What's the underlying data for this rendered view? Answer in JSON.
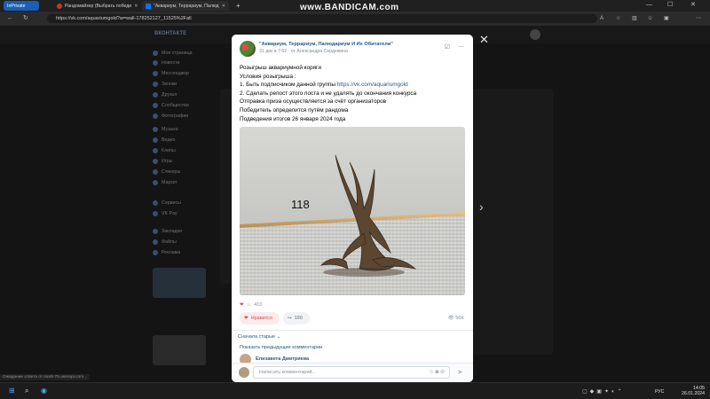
{
  "browser": {
    "inprivate_label": "InPrivate",
    "tabs": [
      {
        "label": "Рандомайзер (Выбрать победи",
        "favicon_color": "#c0392b"
      },
      {
        "label": "\"Аквариум, Террариум, Палюд",
        "favicon_color": "#0077ff"
      }
    ],
    "url": "https://vk.com/aquariumgold?w=wall-178252127_11525%2Fall",
    "watermark": "www.BANDICAM.com",
    "status_text": "Ожидание ответа от sun9-75.userapi.com..."
  },
  "vk": {
    "logo": "ВКОНТАКТЕ",
    "sidebar": [
      "Моя страница",
      "Новости",
      "Мессенджер",
      "Звонки",
      "Друзья",
      "Сообщества",
      "Фотографии",
      "Музыка",
      "Видео",
      "Клипы",
      "Игры",
      "Стикеры",
      "Маркет",
      "Сервисы",
      "VK Pay",
      "Закладки",
      "Файлы",
      "Реклама"
    ]
  },
  "post": {
    "group_name": "\"Аквариум, Террариум, Палюдариум И Их Обитатели\"",
    "meta": "31 дек в 7:52 · от Александра Сердюкина",
    "lines": [
      "Розыгрыш аквариумной коряги",
      "Условия розыгрыша :",
      "1. Быть подписчиком данной группы ",
      "2. Сделать репост этого поста и не удалять до окончания конкурса",
      "Отправка приза осуществляется за счёт организаторов",
      "Победитель определится путём рандома",
      "Подведения итогов 26 января 2024 года"
    ],
    "group_link": "https://vk.com/aquariumgold",
    "photo_label": "118",
    "reactions_count": "410",
    "like_label": "Нравится",
    "share_count": "190",
    "views": "56K",
    "sort_label": "Сначала старые",
    "prev_comments_label": "Показать предыдущие комментарии",
    "commenter": "Елизавета Дмитриева",
    "comment_placeholder": "Написать комментарий..."
  },
  "taskbar": {
    "lang": "РУС",
    "time": "14:05",
    "date": "26.01.2024"
  }
}
